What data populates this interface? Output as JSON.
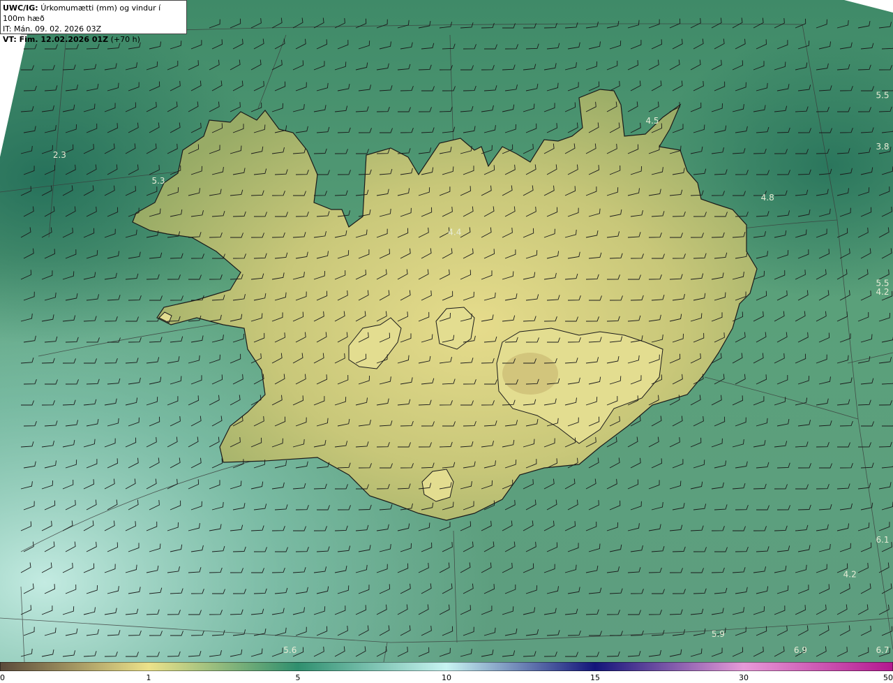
{
  "header": {
    "title_bold": "UWC/IG:",
    "title_rest": "Úrkomumætti (mm) og vindur í 100m hæð",
    "it_line": "IT: Mán. 09. 02. 2026 03Z",
    "vt_bold": "VT: Fim. 12.02.2026 01Z",
    "vt_rest": "(+70 h)"
  },
  "value_labels": [
    {
      "text": "2.3",
      "lon": -23.2,
      "lat": 66.0
    },
    {
      "text": "5.3",
      "lon": -22.0,
      "lat": 65.85
    },
    {
      "text": "4.5",
      "lon": -16.0,
      "lat": 66.2
    },
    {
      "text": "4.8",
      "lon": -14.6,
      "lat": 65.75
    },
    {
      "text": "4.4",
      "lon": -18.4,
      "lat": 65.55
    },
    {
      "text": "5.5",
      "lon": -11.8,
      "lat": 66.35
    },
    {
      "text": "3.8",
      "lon": -11.6,
      "lat": 66.05
    },
    {
      "text": "5.5",
      "lon": -12.6,
      "lat": 65.25
    },
    {
      "text": "4.2",
      "lon": -12.1,
      "lat": 65.2
    },
    {
      "text": "6.1",
      "lon": -12.6,
      "lat": 63.75
    },
    {
      "text": "4.2",
      "lon": -13.6,
      "lat": 63.55
    },
    {
      "text": "5.9",
      "lon": -15.2,
      "lat": 63.2
    },
    {
      "text": "6.9",
      "lon": -14.2,
      "lat": 62.95
    },
    {
      "text": "6.7",
      "lon": -13.1,
      "lat": 62.8
    },
    {
      "text": "5.6",
      "lon": -20.4,
      "lat": 62.75
    }
  ],
  "colorbar": {
    "ticks": [
      "0",
      "1",
      "5",
      "10",
      "15",
      "30",
      "50"
    ],
    "stops": [
      {
        "v": 0,
        "color": "#5a4a3a"
      },
      {
        "v": 1,
        "color": "#ece28a"
      },
      {
        "v": 5,
        "color": "#2f8f6e"
      },
      {
        "v": 10,
        "color": "#c8f4f2"
      },
      {
        "v": 15,
        "color": "#13157a"
      },
      {
        "v": 30,
        "color": "#e79ad8"
      },
      {
        "v": 50,
        "color": "#b3178f"
      }
    ]
  },
  "colors": {
    "sea_dark": "#2f7b63",
    "sea_mid": "#4d9a74",
    "sea_light": "#9fd6c8",
    "land_low": "#a7b267",
    "land_high": "#e1d888",
    "coast": "#1a1a1a",
    "grid": "#3a3a3a"
  }
}
